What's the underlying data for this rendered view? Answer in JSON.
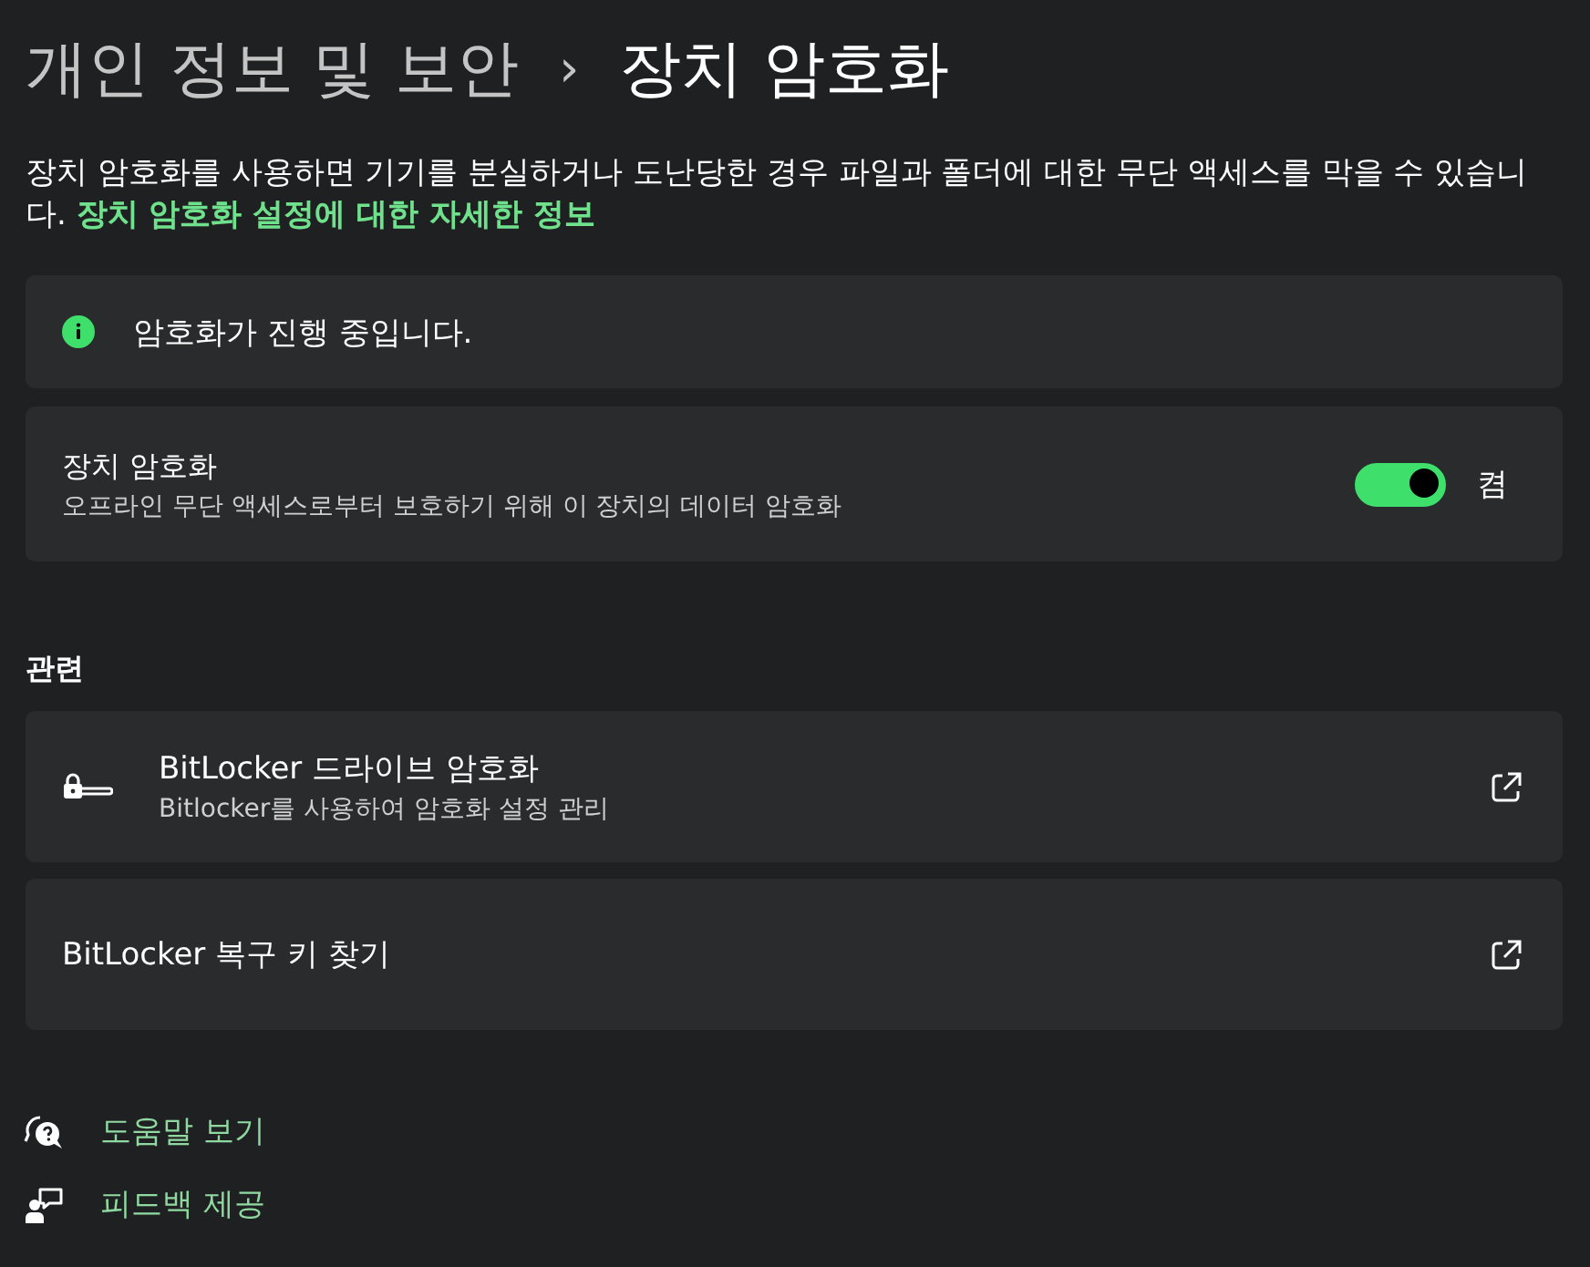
{
  "breadcrumb": {
    "parent": "개인 정보 및 보안",
    "separator": "›",
    "current": "장치 암호화"
  },
  "description": {
    "text": "장치 암호화를 사용하면 기기를 분실하거나 도난당한 경우 파일과 폴더에 대한 무단 액세스를 막을 수 있습니다.",
    "link": "장치 암호화 설정에 대한 자세한 정보"
  },
  "status": {
    "text": "암호화가 진행 중입니다."
  },
  "setting": {
    "title": "장치 암호화",
    "subtitle": "오프라인 무단 액세스로부터 보호하기 위해 이 장치의 데이터 암호화",
    "toggle": {
      "on": true,
      "label": "켬"
    }
  },
  "related": {
    "heading": "관련",
    "items": [
      {
        "kind": "lock",
        "title": "BitLocker 드라이브 암호화",
        "subtitle": "Bitlocker를 사용하여 암호화 설정 관리"
      },
      {
        "kind": "plain",
        "title": "BitLocker 복구 키 찾기"
      }
    ]
  },
  "footer_links": [
    {
      "kind": "help",
      "label": "도움말 보기"
    },
    {
      "kind": "feedback",
      "label": "피드백 제공"
    }
  ]
}
